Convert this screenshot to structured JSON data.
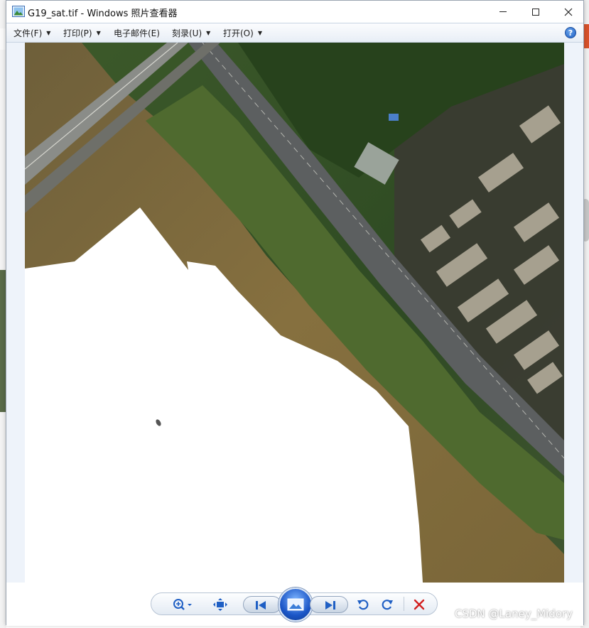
{
  "window": {
    "title": "G19_sat.tif - Windows 照片查看器"
  },
  "menu": {
    "items": [
      {
        "label": "文件(F)"
      },
      {
        "label": "打印(P)"
      },
      {
        "label": "电子邮件(E)"
      },
      {
        "label": "刻录(U)"
      },
      {
        "label": "打开(O)"
      }
    ],
    "help_label": "?"
  },
  "image": {
    "name": "G19_sat.tif"
  },
  "watermark": "CSDN @Laney_Midory",
  "colors": {
    "accent": "#1f5fc4",
    "delete_red": "#d21f1f",
    "river": "#7c6a3b",
    "vegetation": "#2f4f22"
  },
  "icons": {
    "zoom": "zoom-icon",
    "fit": "fit-to-window-icon",
    "previous": "previous-icon",
    "slideshow": "slideshow-icon",
    "next": "next-icon",
    "rotate_ccw": "rotate-counterclockwise-icon",
    "rotate_cw": "rotate-clockwise-icon",
    "delete": "delete-icon"
  }
}
